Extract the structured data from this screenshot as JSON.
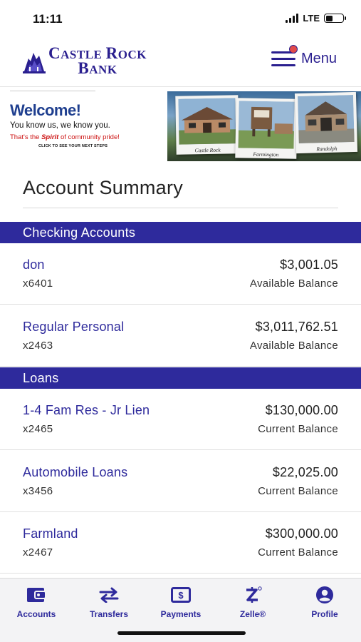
{
  "status": {
    "time": "11:11",
    "network": "LTE"
  },
  "header": {
    "bank_name_line1": "Castle Rock",
    "bank_name_line2": "Bank",
    "menu_label": "Menu"
  },
  "banner": {
    "welcome": "Welcome!",
    "tagline": "You know us, we know you.",
    "spirit_pre": "That's the ",
    "spirit_word": "Spirit",
    "spirit_post": " of community pride!",
    "click_line": "CLICK TO SEE YOUR NEXT STEPS",
    "photos": [
      "Castle Rock",
      "Farmington",
      "Randolph"
    ]
  },
  "summary": {
    "title": "Account Summary"
  },
  "sections": {
    "checking": {
      "title": "Checking Accounts",
      "accounts": [
        {
          "name": "don",
          "number": "x6401",
          "amount": "$3,001.05",
          "balance_label": "Available Balance"
        },
        {
          "name": "Regular Personal",
          "number": "x2463",
          "amount": "$3,011,762.51",
          "balance_label": "Available Balance"
        }
      ]
    },
    "loans": {
      "title": "Loans",
      "accounts": [
        {
          "name": "1-4 Fam Res - Jr Lien",
          "number": "x2465",
          "amount": "$130,000.00",
          "balance_label": "Current Balance"
        },
        {
          "name": "Automobile Loans",
          "number": "x3456",
          "amount": "$22,025.00",
          "balance_label": "Current Balance"
        },
        {
          "name": "Farmland",
          "number": "x2467",
          "amount": "$300,000.00",
          "balance_label": "Current Balance"
        }
      ]
    }
  },
  "nav": {
    "items": [
      {
        "label": "Accounts",
        "icon": "wallet-icon"
      },
      {
        "label": "Transfers",
        "icon": "transfer-arrows-icon"
      },
      {
        "label": "Payments",
        "icon": "payment-bill-icon"
      },
      {
        "label": "Zelle®",
        "icon": "zelle-icon"
      },
      {
        "label": "Profile",
        "icon": "profile-user-icon"
      }
    ]
  },
  "colors": {
    "brand": "#2e2a9c",
    "logo": "#2a1f8f",
    "welcome": "#1f3f8f",
    "accent_red": "#cc1111"
  }
}
